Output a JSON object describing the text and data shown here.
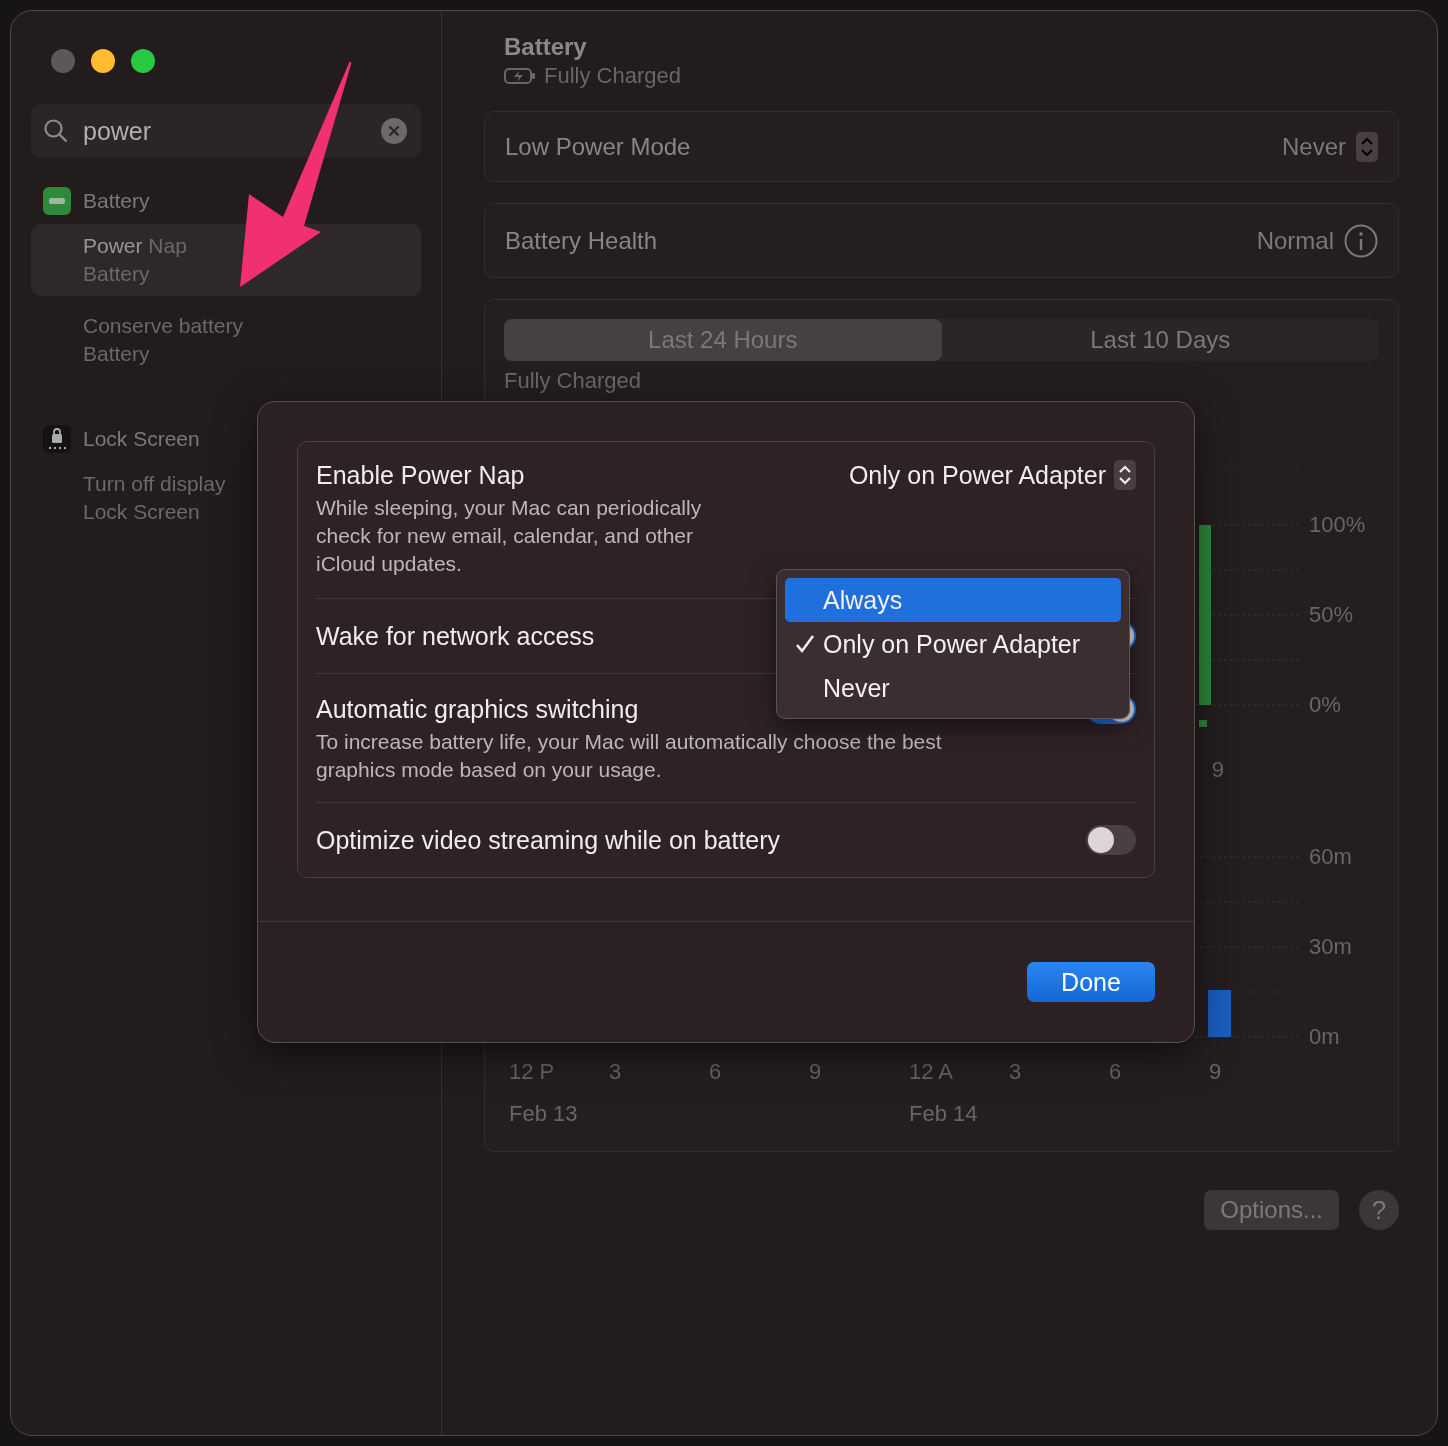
{
  "window_controls": [
    {
      "color": "#5b5859"
    },
    {
      "color": "#febc2e"
    },
    {
      "color": "#28c840"
    }
  ],
  "sidebar": {
    "search": {
      "value": "power"
    },
    "groups": [
      {
        "kind": "battery",
        "title": "Battery",
        "results": [
          {
            "title": "**Power** Nap",
            "subtitle": "Battery",
            "selected": true
          },
          {
            "title": "Conserve battery",
            "subtitle": "Battery",
            "selected": false
          }
        ]
      },
      {
        "kind": "lock",
        "title": "Lock Screen",
        "results": [
          {
            "title": "Turn off display",
            "subtitle": "Lock Screen",
            "selected": false
          }
        ]
      }
    ]
  },
  "header": {
    "title": "Battery",
    "subtitle": "Fully Charged"
  },
  "settings": [
    {
      "kind": "popup",
      "label": "Low Power Mode",
      "value": "Never"
    },
    {
      "kind": "info",
      "label": "Battery Health",
      "value": "Normal"
    }
  ],
  "history": {
    "tabs": [
      {
        "label": "Last 24 Hours",
        "selected": true
      },
      {
        "label": "Last 10 Days",
        "selected": false
      }
    ],
    "caption": "Fully Charged",
    "level_axis": [
      "100%",
      "50%",
      "0%"
    ],
    "level_x_label": "9",
    "usage_axis": [
      "60m",
      "30m",
      "0m"
    ],
    "x_labels": [
      "12 P",
      "3",
      "6",
      "9",
      "12 A",
      "3",
      "6",
      "9"
    ],
    "dates": [
      "Feb 13",
      "Feb 14"
    ]
  },
  "footer": {
    "options_button": "Options...",
    "help_button": "?"
  },
  "sheet": {
    "rows": [
      {
        "kind": "popup",
        "title": "Enable Power Nap",
        "description": "While sleeping, your Mac can periodically check for new email, calendar, and other iCloud updates.",
        "value": "Only on Power Adapter"
      },
      {
        "kind": "toggle",
        "title": "Wake for network access",
        "on": true
      },
      {
        "kind": "toggle",
        "title": "Automatic graphics switching",
        "description": "To increase battery life, your Mac will automatically choose the best graphics mode based on your usage.",
        "on": true
      },
      {
        "kind": "toggle",
        "title": "Optimize video streaming while on battery",
        "on": false
      }
    ],
    "done_button": "Done",
    "menu": [
      {
        "label": "Always",
        "highlighted": true,
        "checked": false
      },
      {
        "label": "Only on Power Adapter",
        "highlighted": false,
        "checked": true
      },
      {
        "label": "Never",
        "highlighted": false,
        "checked": false
      }
    ]
  }
}
